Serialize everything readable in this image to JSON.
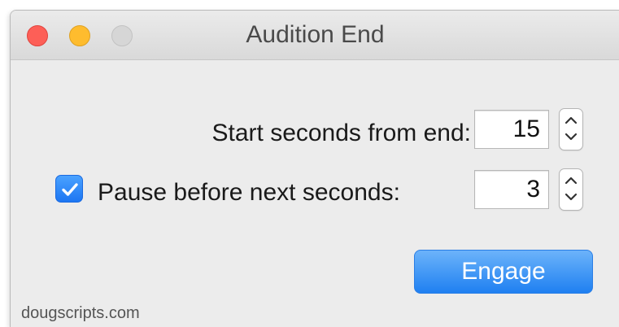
{
  "window": {
    "title": "Audition End"
  },
  "traffic_lights": {
    "close": "close-button",
    "minimize": "minimize-button",
    "zoom": "zoom-button"
  },
  "start": {
    "label": "Start seconds from end:",
    "value": "15"
  },
  "pause": {
    "label": "Pause before next seconds:",
    "value": "3",
    "checked": true
  },
  "actions": {
    "engage_label": "Engage"
  },
  "footer": {
    "text": "dougscripts.com"
  },
  "colors": {
    "accent": "#1f80f1",
    "close": "#fd5f57",
    "minimize": "#febc2e",
    "zoom_disabled": "#d6d6d6"
  },
  "icons": {
    "checkbox": "checkmark-icon",
    "stepper_up": "chevron-up-icon",
    "stepper_down": "chevron-down-icon"
  }
}
